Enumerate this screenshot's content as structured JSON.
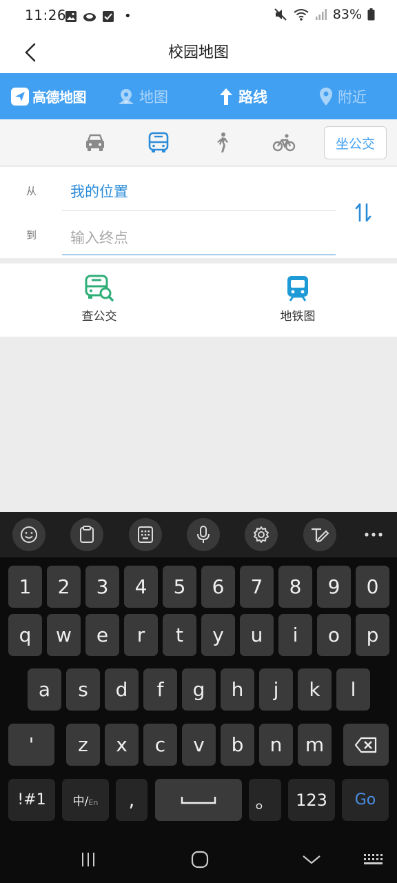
{
  "status_bar": {
    "time": "11:26",
    "battery": "83%",
    "dot": "•",
    "left_icons": [
      "image-icon",
      "cloud-icon",
      "check-box-icon"
    ],
    "right_icons": [
      "mute-icon",
      "wifi-icon",
      "signal-icon",
      "battery-icon"
    ]
  },
  "header": {
    "title": "校园地图"
  },
  "amap_nav": {
    "logo_text": "高德地图",
    "tabs": [
      {
        "label": "地图",
        "icon": "map-pin-icon",
        "active": false
      },
      {
        "label": "路线",
        "icon": "route-arrow-icon",
        "active": true
      },
      {
        "label": "附近",
        "icon": "location-pin-icon",
        "active": false
      }
    ]
  },
  "transport_modes": {
    "items": [
      "car-icon",
      "bus-icon",
      "walk-icon",
      "bike-icon"
    ],
    "selected": "bus-icon",
    "ride_button": "坐公交"
  },
  "route": {
    "from_label": "从",
    "from_value": "我的位置",
    "to_label": "到",
    "to_placeholder": "输入终点"
  },
  "quick_actions": [
    {
      "label": "查公交",
      "icon": "bus-search-icon"
    },
    {
      "label": "地铁图",
      "icon": "subway-icon"
    }
  ],
  "keyboard": {
    "toolbar": [
      "emoji-icon",
      "clipboard-icon",
      "keypad-icon",
      "microphone-icon",
      "settings-icon",
      "handwriting-icon",
      "more-icon"
    ],
    "row_numbers": [
      "1",
      "2",
      "3",
      "4",
      "5",
      "6",
      "7",
      "8",
      "9",
      "0"
    ],
    "row_q": [
      "q",
      "w",
      "e",
      "r",
      "t",
      "y",
      "u",
      "i",
      "o",
      "p"
    ],
    "row_a": [
      "a",
      "s",
      "d",
      "f",
      "g",
      "h",
      "j",
      "k",
      "l"
    ],
    "row_z": [
      "'",
      "z",
      "x",
      "c",
      "v",
      "b",
      "n",
      "m"
    ],
    "symbols_key": "!#1",
    "lang_key_main": "中/",
    "lang_key_sub": "En",
    "comma_key": ",",
    "period_key": "。",
    "numbers_key": "123",
    "go_key": "Go",
    "colors": {
      "go": "#4a8fe6"
    }
  },
  "nav_bar": [
    "recent-apps-icon",
    "home-icon",
    "back-down-icon",
    "keyboard-grid-icon"
  ],
  "colors": {
    "primary": "#42a0f2",
    "accent_text": "#2b8cd9",
    "green": "#2fae78"
  }
}
